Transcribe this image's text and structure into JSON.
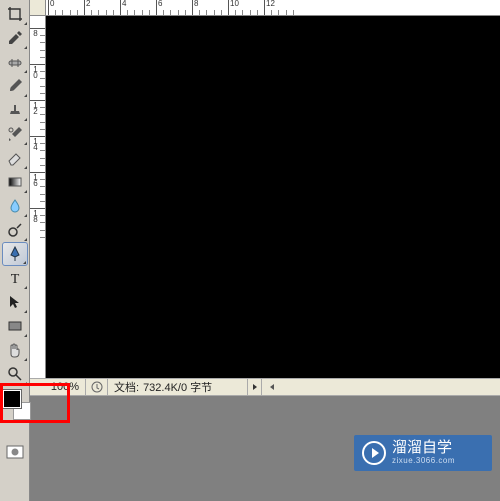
{
  "tools": [
    {
      "name": "crop-tool"
    },
    {
      "name": "eyedropper-tool"
    },
    {
      "name": "healing-brush-tool"
    },
    {
      "name": "brush-tool"
    },
    {
      "name": "clone-stamp-tool"
    },
    {
      "name": "history-brush-tool"
    },
    {
      "name": "eraser-tool"
    },
    {
      "name": "gradient-tool"
    },
    {
      "name": "blur-tool"
    },
    {
      "name": "dodge-tool"
    },
    {
      "name": "pen-tool",
      "active": true
    },
    {
      "name": "type-tool"
    },
    {
      "name": "path-selection-tool"
    },
    {
      "name": "rectangle-shape-tool"
    },
    {
      "name": "hand-tool"
    },
    {
      "name": "zoom-tool"
    }
  ],
  "colors": {
    "foreground": "#000000",
    "background": "#ffffff"
  },
  "status": {
    "zoom": "100%",
    "doc_label": "文档:",
    "doc_value": "732.4K/0 字节"
  },
  "ruler": {
    "h_major": [
      0,
      2,
      4,
      6,
      8,
      10,
      12
    ],
    "v_major": [
      8,
      10,
      12,
      14,
      16,
      18
    ],
    "h_label_offset": 36,
    "v_label_start": 12
  },
  "watermark": {
    "text": "溜溜自学",
    "sub": "zixue.3066.com"
  }
}
